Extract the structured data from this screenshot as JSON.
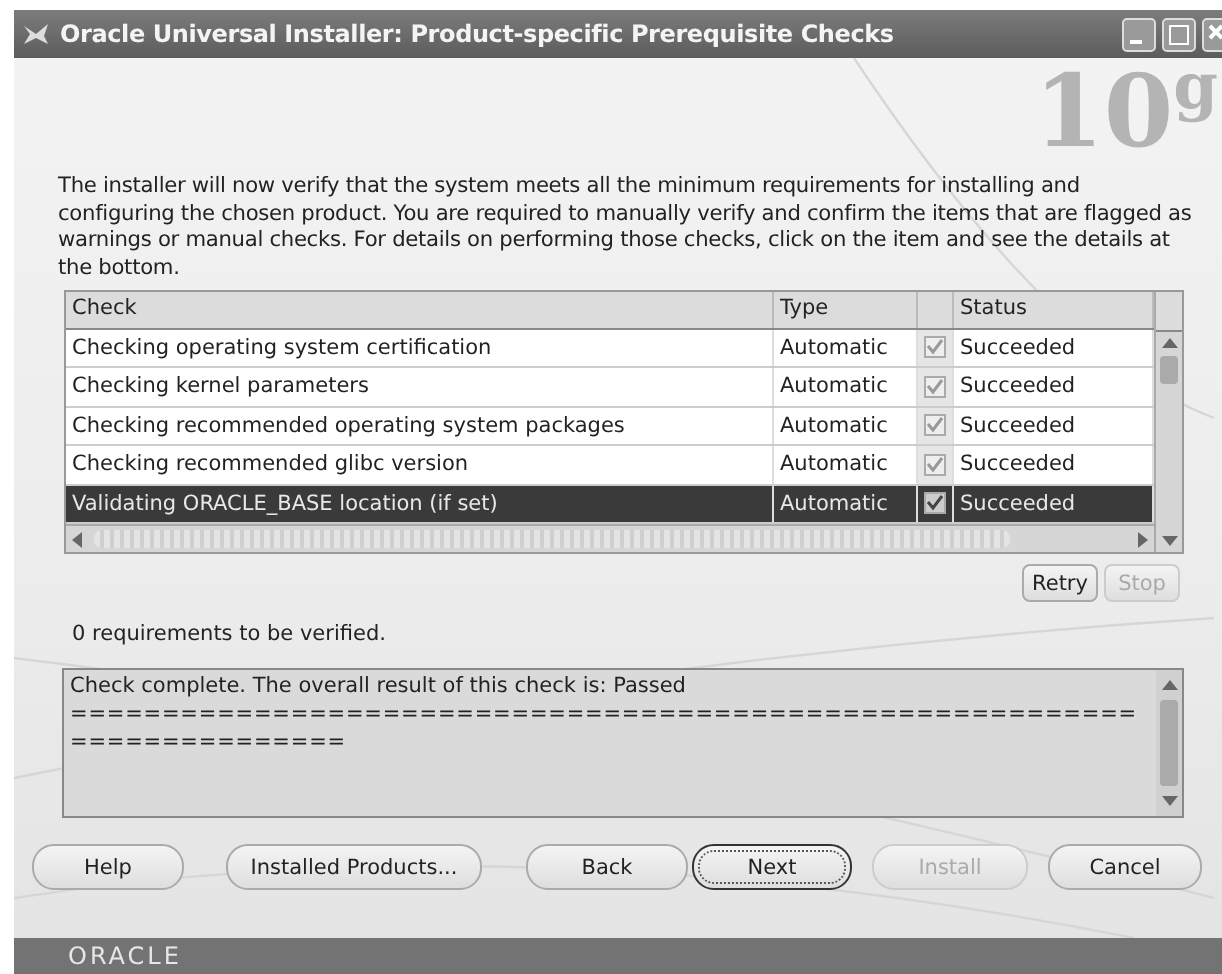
{
  "window": {
    "title": "Oracle Universal Installer: Product-specific Prerequisite Checks"
  },
  "brand_mark": "10$^{g}$",
  "intro": "The installer will now verify that the system meets all the minimum requirements for installing and configuring the chosen product. You are required to manually verify and confirm the items that are flagged as warnings or manual checks. For details on performing those checks, click on the item and see the details at the bottom.",
  "table": {
    "columns": [
      "Check",
      "Type",
      "Status"
    ],
    "rows": [
      {
        "check": "Checking operating system certification",
        "type": "Automatic",
        "checked": true,
        "status": "Succeeded",
        "selected": false
      },
      {
        "check": "Checking kernel parameters",
        "type": "Automatic",
        "checked": true,
        "status": "Succeeded",
        "selected": false
      },
      {
        "check": "Checking recommended operating system packages",
        "type": "Automatic",
        "checked": true,
        "status": "Succeeded",
        "selected": false
      },
      {
        "check": "Checking recommended glibc version",
        "type": "Automatic",
        "checked": true,
        "status": "Succeeded",
        "selected": false
      },
      {
        "check": "Validating ORACLE_BASE location (if set)",
        "type": "Automatic",
        "checked": true,
        "status": "Succeeded",
        "selected": true
      }
    ]
  },
  "table_buttons": [
    {
      "label": "Retry",
      "disabled": false
    },
    {
      "label": "Stop",
      "disabled": true
    }
  ],
  "summary": "0 requirements to be verified.",
  "details": {
    "lines": [
      "Check complete. The overall result of this check is: Passed",
      "==========================================================",
      "==============="
    ]
  },
  "buttons": [
    {
      "label": "Help",
      "disabled": false,
      "focused": false
    },
    {
      "label": "Installed Products...",
      "disabled": false,
      "focused": false
    },
    {
      "label": "Back",
      "disabled": false,
      "focused": false
    },
    {
      "label": "Next",
      "disabled": false,
      "focused": true
    },
    {
      "label": "Install",
      "disabled": true,
      "focused": false
    },
    {
      "label": "Cancel",
      "disabled": false,
      "focused": false
    }
  ],
  "footer": {
    "logo": "ORACLE"
  }
}
